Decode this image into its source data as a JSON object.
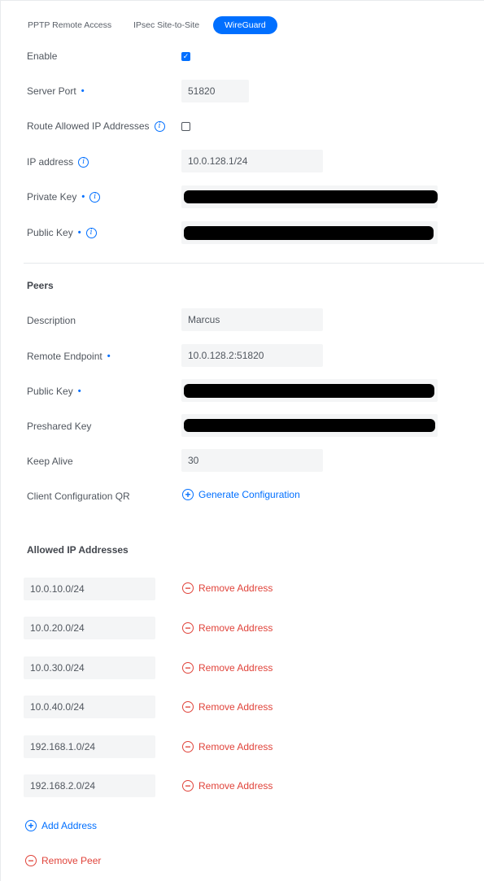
{
  "tabs": {
    "pptp": "PPTP Remote Access",
    "ipsec": "IPsec Site-to-Site",
    "wireguard": "WireGuard"
  },
  "form": {
    "enable_label": "Enable",
    "enable_checked": true,
    "server_port_label": "Server Port",
    "server_port_value": "51820",
    "route_allowed_label": "Route Allowed IP Addresses",
    "route_allowed_checked": false,
    "ip_address_label": "IP address",
    "ip_address_value": "10.0.128.1/24",
    "private_key_label": "Private Key",
    "public_key_label": "Public Key"
  },
  "peers": {
    "heading": "Peers",
    "description_label": "Description",
    "description_value": "Marcus",
    "remote_endpoint_label": "Remote Endpoint",
    "remote_endpoint_value": "10.0.128.2:51820",
    "public_key_label": "Public Key",
    "preshared_key_label": "Preshared Key",
    "keep_alive_label": "Keep Alive",
    "keep_alive_value": "30",
    "client_qr_label": "Client Configuration QR",
    "generate_label": "Generate Configuration"
  },
  "allowed": {
    "heading": "Allowed IP Addresses",
    "addresses": [
      "10.0.10.0/24",
      "10.0.20.0/24",
      "10.0.30.0/24",
      "10.0.40.0/24",
      "192.168.1.0/24",
      "192.168.2.0/24"
    ],
    "remove_label": "Remove Address",
    "add_label": "Add Address",
    "remove_peer_label": "Remove Peer"
  },
  "colors": {
    "accent": "#006fff",
    "danger": "#e0433a",
    "input_bg": "#f4f5f6"
  }
}
